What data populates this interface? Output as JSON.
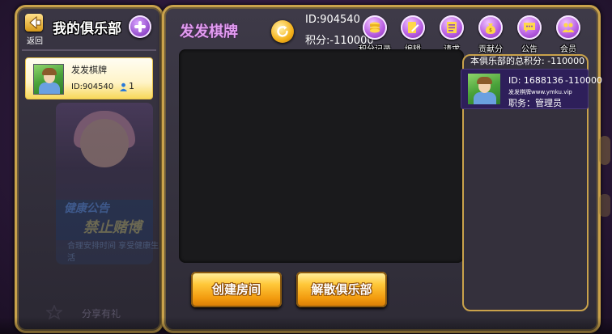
{
  "left_panel": {
    "back_label": "返回",
    "title": "我的俱乐部",
    "club": {
      "name": "发发棋牌",
      "id": "ID:904540",
      "members": "1"
    },
    "bg_text_1": "健康公告",
    "bg_text_2": "禁止赌博",
    "bg_text_3": "合理安排时间 享受健康生活",
    "share_label": "分享有礼"
  },
  "main_panel": {
    "title": "发发棋牌",
    "id": "ID:904540",
    "score": "积分:-110000",
    "tabs": [
      {
        "label": "积分记录",
        "icon": "coins-icon"
      },
      {
        "label": "编辑",
        "icon": "edit-icon"
      },
      {
        "label": "请求",
        "icon": "request-icon"
      },
      {
        "label": "贡献分",
        "icon": "moneybag-icon"
      },
      {
        "label": "公告",
        "icon": "speech-bubble-icon"
      },
      {
        "label": "会员",
        "icon": "members-icon"
      }
    ],
    "buttons": {
      "create_room": "创建房间",
      "dissolve_club": "解散俱乐部"
    },
    "member_list": {
      "total_score": "本俱乐部的总积分: -110000",
      "members": [
        {
          "id": "ID:  1688136",
          "score": "-110000",
          "name": "发发棋牌www.ymku.vip",
          "role": "职务：管理员"
        }
      ]
    }
  },
  "colors": {
    "border_gold": "#c9a24b",
    "title_purple": "#e29cf0",
    "button_orange": "#f29a0e",
    "tab_purple": "#b55be0",
    "card_yellow": "#fff4c8",
    "member_card_bg": "#2e1f5a"
  }
}
